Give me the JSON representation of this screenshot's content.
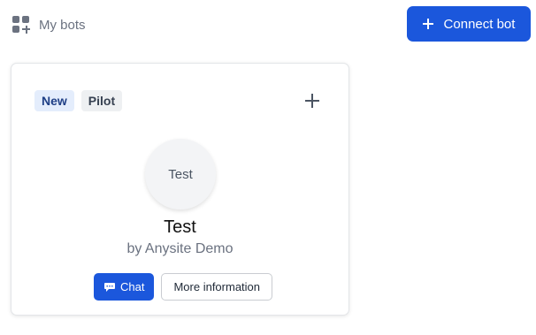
{
  "header": {
    "nav_label": "My bots",
    "nav_icon": "grid-plus-icon",
    "connect_label": "Connect bot",
    "accent_color": "#1b57dc"
  },
  "card": {
    "tags": [
      {
        "label": "New"
      },
      {
        "label": "Pilot"
      }
    ],
    "avatar_text": "Test",
    "name": "Test",
    "owner": "by Anysite Demo",
    "chat_label": "Chat",
    "chat_icon": "chat-bubble-icon",
    "more_info_label": "More information"
  }
}
